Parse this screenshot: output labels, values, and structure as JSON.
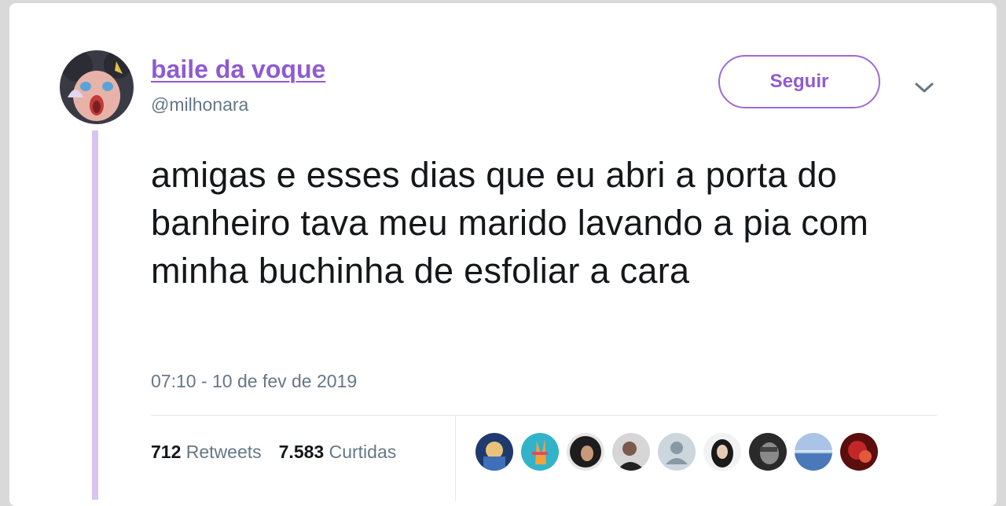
{
  "tweet": {
    "author_name": "baile da voque",
    "author_handle": "@milhonara",
    "follow_label": "Seguir",
    "text": "amigas e esses dias que eu abri a porta do banheiro tava meu marido lavando a pia com minha buchinha de esfoliar a cara",
    "timestamp": "07:10 - 10 de fev de 2019",
    "retweets_count": "712",
    "retweets_label": "Retweets",
    "likes_count": "7.583",
    "likes_label": "Curtidas"
  },
  "icons": {
    "menu": "chevron-down-icon"
  },
  "colors": {
    "accent": "#8f5bd0",
    "thread_line": "#d9c3f0",
    "text": "#14171a",
    "secondary_text": "#657786"
  }
}
